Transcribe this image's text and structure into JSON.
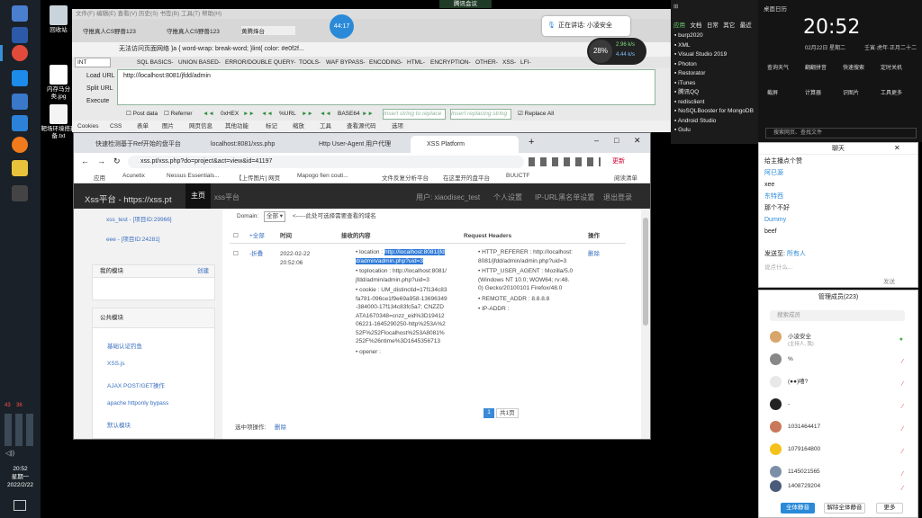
{
  "taskbar": {
    "clock_time": "20:52",
    "clock_day": "星期一",
    "clock_date": "2022/2/22",
    "tray_badge_1": "43",
    "tray_badge_2": "36"
  },
  "desktop_icons": [
    {
      "label": "回收站"
    },
    {
      "label": "内存马分类.jpg"
    },
    {
      "label": "靶场环境搭建备.txt"
    }
  ],
  "meeting_indicator": "腾讯会议",
  "meeting_bar": {
    "speaker": "正在讲话: 小凌安全"
  },
  "bubble_time": "44:17",
  "net_widget": {
    "percent": "28%",
    "up": "2.96 k/s",
    "down": "4.44 k/s"
  },
  "firefox": {
    "tabs": [
      "守推真人CS野兽123",
      "守推真人CS野兽123",
      "黄腾烽台"
    ],
    "page_code": "无法访问页面网络  }a { word-wrap: break-word; }lint{ color: #e0f2f...",
    "hackbar_select": "INT",
    "hackbar_menu": [
      "SQL BASICS-",
      "UNION BASED-",
      "ERROR/DOUBLE QUERY-",
      "TOOLS-",
      "WAF BYPASS-",
      "ENCODING-",
      "HTML-",
      "ENCRYPTION-",
      "OTHER-",
      "XSS-",
      "LFI-"
    ],
    "load_url": "Load URL",
    "split_url": "Split URL",
    "execute": "Execute",
    "url_value": "http://localhost:8081/jfdd/admin",
    "post_data": "Post data",
    "referrer": "Referrer",
    "hex_label": "0xHEX",
    "url_label": "%URL",
    "base64_label": "BASE64",
    "insert_replace": "Insert string to replace",
    "insert_replacing": "Insert replacing string",
    "replace_all": "Replace All",
    "bookmarks": [
      "Cookies",
      "CSS",
      "表单",
      "图片",
      "网页信息",
      "其他功能",
      "标记",
      "缩放",
      "工具",
      "查看源代码",
      "选项"
    ]
  },
  "chrome": {
    "tabs": [
      "快速检测基于Ref开始的盘平台",
      "localhost:8081/xss.php",
      "Http User-Agent 用户代理",
      "XSS Platform"
    ],
    "address": "xss.pt/xss.php?do=project&act=view&id=41197",
    "update_label": "更新",
    "bookmarks": [
      "应用",
      "Acunetix",
      "Nessus Essentials...",
      "【上传图片] 网页",
      "Mapogo fien couti...",
      "文件反复分析平台",
      "在这里开的盘平台",
      "BUUCTF",
      "阅读清单"
    ],
    "nav": {
      "logo": "Xss平台 - https://xss.pt",
      "home": "主页",
      "xss_platform": "xss平台",
      "user": "用户: xiaodisec_test",
      "settings": "个人设置",
      "ip_url": "IP-URL黑名单设置",
      "logout": "退出登录"
    },
    "sidebar": {
      "projects": [
        "xss_test - [项目ID:29966]",
        "eee - [项目ID:24281]"
      ],
      "my_modules": "我的模块",
      "create": "创建",
      "public_modules": "公共模块",
      "public_items": [
        "基础认证钓鱼",
        "XSS.js",
        "AJAX POST/GET操作",
        "apache httponly bypass",
        "默认模块"
      ]
    },
    "main": {
      "domain_label": "Domain:",
      "domain_select": "全部",
      "domain_hint": "<-----此处可选择需要查看的域名",
      "col_expand_all": "+全部",
      "col_time": "时间",
      "col_content": "接收的内容",
      "col_headers": "Request Headers",
      "col_action": "操作",
      "row_toggle": "-折叠",
      "row_time": "2022-02-22 20:52:06",
      "location_label": "location :",
      "location_value": "http://localhost:8081/jfdd/admin/admin.php?uid=3",
      "toplocation": "toplocation : http://localhost:8081/jfdd/admin/admin.php?uid=3",
      "cookie": "cookie : UM_distinctid=17f134c83fa781-096ce1f9e69a958-13696349-384000-17f134c83fc5a7; CNZZDATA1670348=cnzz_eid%3D1941206221-1645290250-http%253A%252F%252Flocalhost%253A8081%252F%26ntime%3D1645356713",
      "opener": "opener :",
      "h_referer": "HTTP_REFERER : http://localhost:8081/jfdd/admin/admin.php?uid=3",
      "h_agent": "HTTP_USER_AGENT : Mozilla/5.0 (Windows NT 10.0; WOW64; rv:48.0) Gecko/20100101 Firefox/48.0",
      "h_remote": "REMOTE_ADDR : 8.8.8.8",
      "h_ip": "IP-ADDR :",
      "delete": "删除",
      "page_current": "1",
      "page_total": "共1页",
      "selected_ops": "选中项操作:",
      "selected_delete": "删除"
    }
  },
  "right_list": {
    "tabs": [
      "应用",
      "文档",
      "日常",
      "其它",
      "最近"
    ],
    "items": [
      "burp2020",
      "XML",
      "Visual Studio 2019",
      "Photon",
      "Restorator",
      "iTunes",
      "腾讯QQ",
      "redisclient",
      "NoSQLBooster for MongoDB",
      "Android Studio",
      "Gulu"
    ]
  },
  "calendar": {
    "header": "桌面日历",
    "time": "20:52",
    "date": "02月22日 星期二",
    "lunar": "壬寅·虎年·正月二十二",
    "tools": [
      "查询天气",
      "翻翻拼音",
      "快速搜索",
      "定时关机",
      "截屏",
      "计算器",
      "识图片",
      "工具更多"
    ],
    "search_placeholder": "搜索网页、查找文件"
  },
  "chat1": {
    "title": "聊天",
    "messages": [
      "给主播点个赞",
      "阿巳源",
      "xee",
      "东特西",
      "那个不好",
      "Dummy",
      "beef"
    ],
    "send_to_label": "发送至:",
    "send_to_value": "所有人",
    "input_placeholder": "说点什么...",
    "send_button": "发送"
  },
  "chat2": {
    "title": "管理成员(223)",
    "search_placeholder": "搜索成员",
    "members": [
      "小凌安全",
      "%",
      "(●●)嘻?",
      "-",
      "1031464417",
      "1079164800",
      "1145021565",
      "1408729204"
    ],
    "member0_tag": "(主持人, 我)",
    "mute_all": "全体静音",
    "unmute_all": "解除全体静音",
    "more": "更多"
  }
}
